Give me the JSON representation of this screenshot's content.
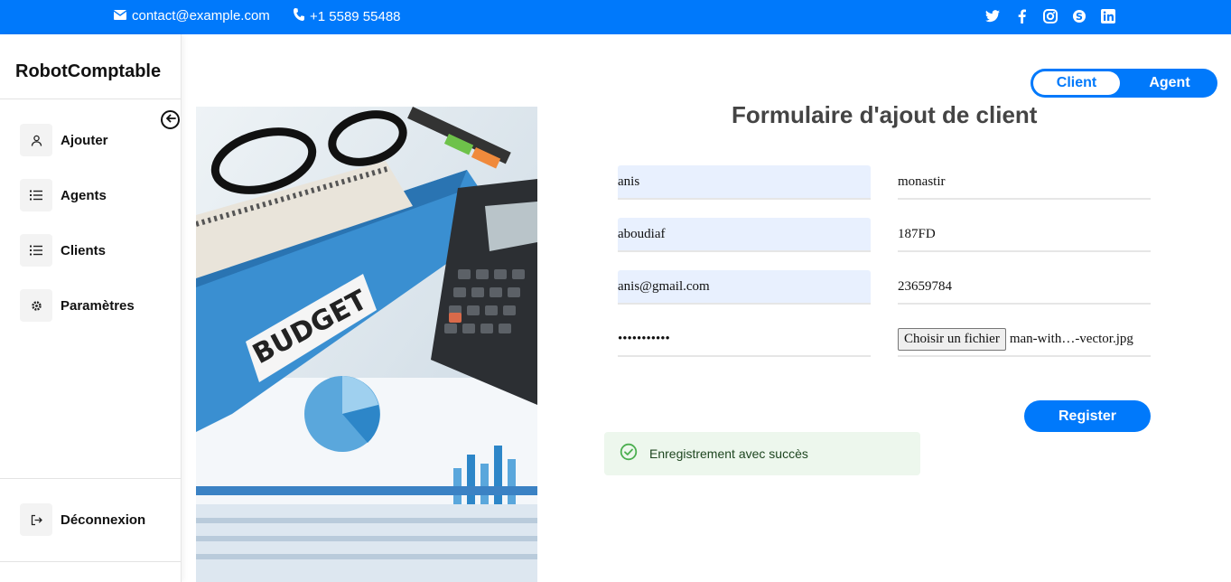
{
  "topbar": {
    "email": "contact@example.com",
    "phone": "+1 5589 55488",
    "socials": [
      "twitter-icon",
      "facebook-icon",
      "instagram-icon",
      "skype-icon",
      "linkedin-icon"
    ]
  },
  "sidebar": {
    "brand": "RobotComptable",
    "items": [
      {
        "label": "Ajouter",
        "icon": "user-icon"
      },
      {
        "label": "Agents",
        "icon": "list-icon"
      },
      {
        "label": "Clients",
        "icon": "list-icon"
      },
      {
        "label": "Paramètres",
        "icon": "gear-icon"
      }
    ],
    "logout": {
      "label": "Déconnexion",
      "icon": "logout-icon"
    }
  },
  "toggle": {
    "client": "Client",
    "agent": "Agent",
    "active": "Client"
  },
  "form": {
    "title": "Formulaire d'ajout de client",
    "first_name": "anis",
    "city": "monastir",
    "last_name": "aboudiaf",
    "code": "187FD",
    "email": "anis@gmail.com",
    "phone": "23659784",
    "password": "•••••••••••",
    "file_button": "Choisir un fichier",
    "file_name": "man-with…-vector.jpg",
    "submit": "Register"
  },
  "alert": {
    "text": "Enregistrement avec succès",
    "severity": "success"
  },
  "colors": {
    "primary": "#0079fb",
    "autofill": "#e8f0fe",
    "success_bg": "#edf7ed",
    "success_icon": "#4caf50"
  }
}
